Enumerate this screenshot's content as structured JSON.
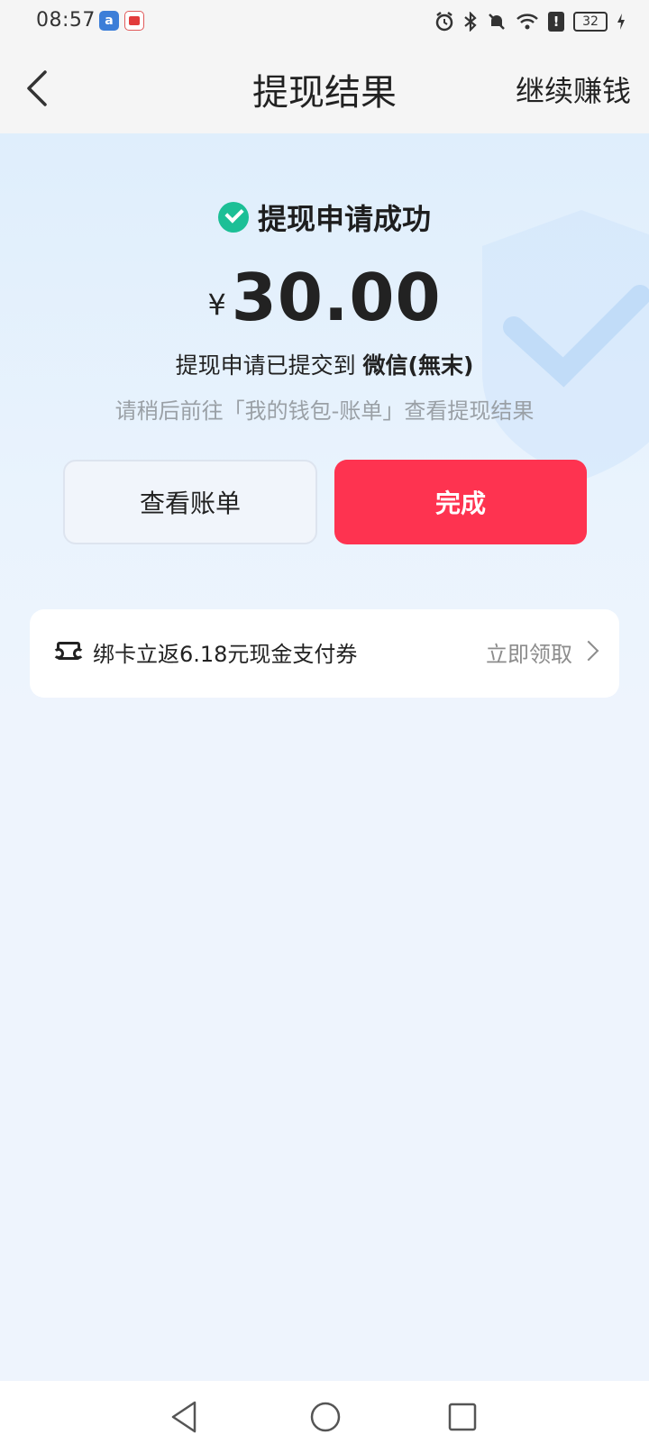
{
  "status_bar": {
    "time": "08:57",
    "app_badge_1": "a",
    "battery": "32",
    "alert": "!"
  },
  "nav": {
    "title": "提现结果",
    "action": "继续赚钱"
  },
  "result": {
    "title": "提现申请成功",
    "currency": "¥",
    "amount": "30.00",
    "submitted_prefix": "提现申请已提交到",
    "destination": "微信(無末)",
    "hint": "请稍后前往「我的钱包-账单」查看提现结果"
  },
  "buttons": {
    "view_bill": "查看账单",
    "done": "完成"
  },
  "promo": {
    "text": "绑卡立返6.18元现金支付券",
    "action": "立即领取"
  },
  "colors": {
    "accent_red": "#fe3350",
    "success_green": "#1cbf96"
  },
  "icons": {
    "back": "chevron-left-icon",
    "success": "check-circle-icon",
    "coupon": "ticket-icon",
    "more": "chevron-right-icon"
  }
}
